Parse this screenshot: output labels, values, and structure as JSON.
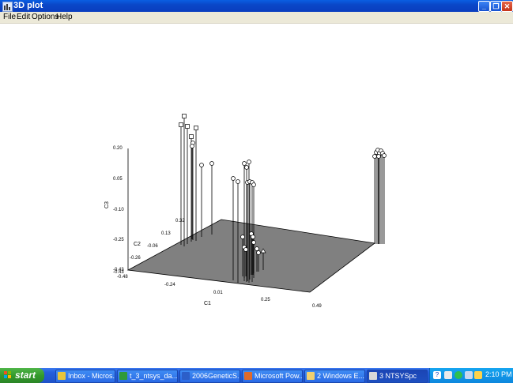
{
  "window": {
    "title": "3D plot"
  },
  "menu": [
    "File",
    "Edit",
    "Options",
    "Help"
  ],
  "plot": {
    "axis_labels": {
      "c1": "C1",
      "c2": "C2",
      "c3": "C3"
    },
    "c1_ticks": [
      "-0.48",
      "-0.24",
      "0.01",
      "0.25",
      "0.49"
    ],
    "c2_ticks": [
      "-0.43",
      "-0.26",
      "-0.06",
      "0.13",
      "0.32"
    ],
    "c3_ticks": [
      "0.20",
      "0.05",
      "-0.10",
      "-0.25",
      "-0.43"
    ],
    "colors": {
      "floor": "#808080",
      "stem": "#000000",
      "marker_fill": "#ffffff"
    }
  },
  "taskbar": {
    "start_label": "start",
    "tasks": [
      {
        "label": "Inbox - Micros...",
        "icon": "outlook-icon",
        "color": "#e8c53a"
      },
      {
        "label": "t_3_ntsys_da...",
        "icon": "excel-icon",
        "color": "#2f9a3a"
      },
      {
        "label": "2006GeneticS...",
        "icon": "word-icon",
        "color": "#2c5fc9"
      },
      {
        "label": "Microsoft Pow...",
        "icon": "powerpoint-icon",
        "color": "#e06a2a"
      },
      {
        "label": "2 Windows E...",
        "icon": "folder-icon",
        "color": "#f0d070"
      },
      {
        "label": "3 NTSYSpc",
        "icon": "ntsys-icon",
        "color": "#d8d8d8",
        "active": true
      }
    ],
    "clock": "2:10 PM"
  }
}
